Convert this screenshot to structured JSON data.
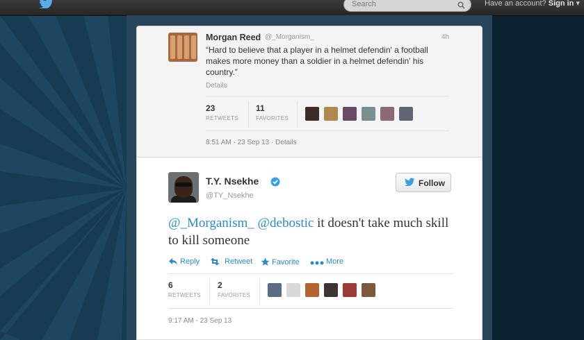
{
  "header": {
    "search_placeholder": "Search",
    "signin_prefix": "Have an account?",
    "signin_label": "Sign in",
    "signin_caret": "▾"
  },
  "tweet1": {
    "name": "Morgan Reed",
    "handle": "@_Morganism_",
    "time": "4h",
    "text": "“Hard to believe that a player in a helmet defendin' a football makes more money than a soldier in a helmet defendin' his country.”",
    "details": "Details",
    "retweets": "23",
    "retweets_label": "RETWEETS",
    "favorites": "11",
    "favorites_label": "FAVORITES",
    "timestamp": "8:51 AM - 23 Sep 13 · Details"
  },
  "tweet2": {
    "name": "T.Y. Nsekhe",
    "handle": "@TY_Nsekhe",
    "follow_label": "Follow",
    "mention1": "@_Morganism_",
    "mention2": "@debostic",
    "text_rest": " it doesn't take much skill to kill someone",
    "actions": {
      "reply": "Reply",
      "retweet": "Retweet",
      "favorite": "Favorite",
      "more": "More"
    },
    "retweets": "6",
    "retweets_label": "RETWEETS",
    "favorites": "2",
    "favorites_label": "FAVORITES",
    "timestamp": "9:17 AM - 23 Sep 13"
  },
  "colors": {
    "link": "#2a8bc6",
    "background": "#0c2637"
  }
}
